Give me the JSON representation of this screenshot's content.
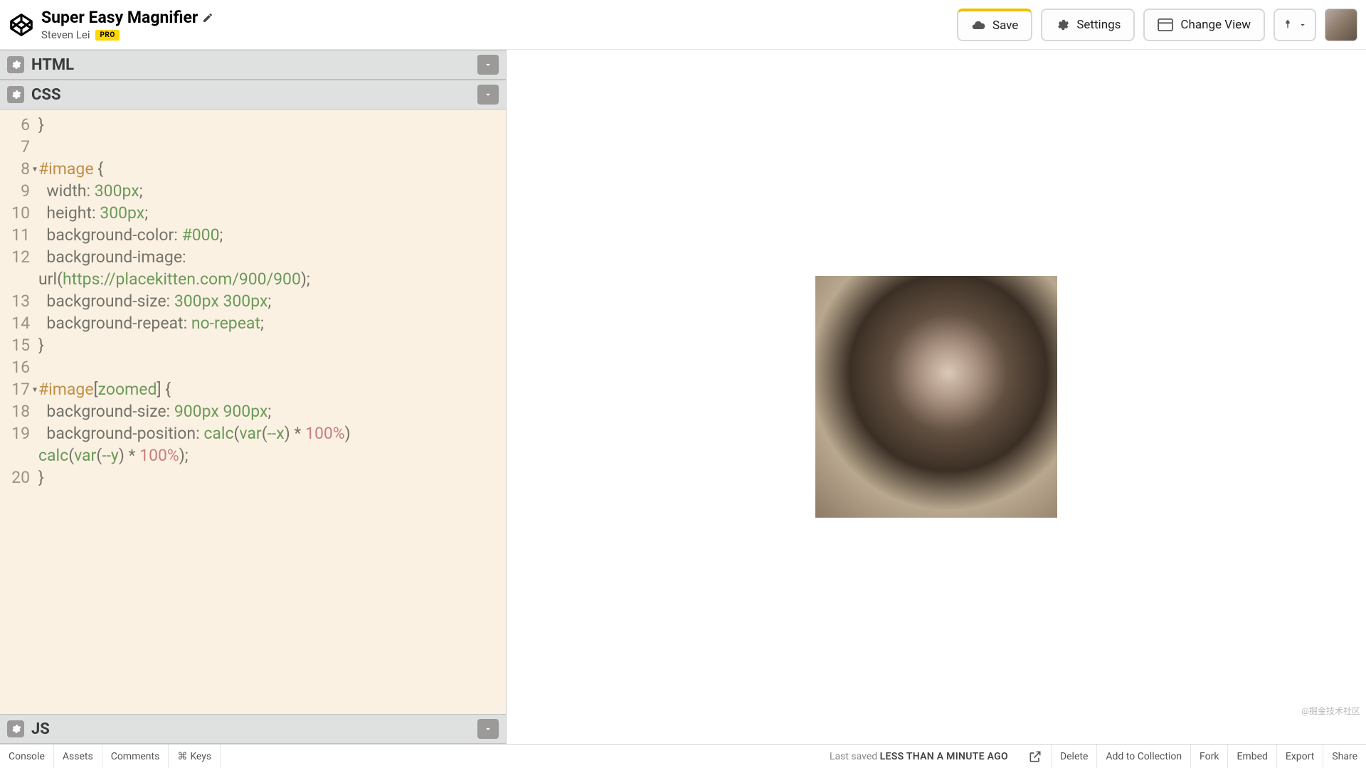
{
  "header": {
    "title": "Super Easy Magnifier",
    "author": "Steven Lei",
    "badge": "PRO"
  },
  "actions": {
    "save": "Save",
    "settings": "Settings",
    "change_view": "Change View"
  },
  "panels": {
    "html": "HTML",
    "css": "CSS",
    "js": "JS"
  },
  "code": {
    "lines": [
      {
        "n": 6,
        "indent": 0,
        "fold": "",
        "tokens": [
          [
            "punc",
            "}"
          ]
        ]
      },
      {
        "n": 7,
        "indent": 0,
        "fold": "",
        "tokens": []
      },
      {
        "n": 8,
        "indent": 0,
        "fold": "▾",
        "tokens": [
          [
            "sel",
            "#image"
          ],
          [
            "punc",
            " {"
          ]
        ]
      },
      {
        "n": 9,
        "indent": 2,
        "fold": "",
        "tokens": [
          [
            "prop",
            "width"
          ],
          [
            "punc",
            ": "
          ],
          [
            "val",
            "300px"
          ],
          [
            "punc",
            ";"
          ]
        ]
      },
      {
        "n": 10,
        "indent": 2,
        "fold": "",
        "tokens": [
          [
            "prop",
            "height"
          ],
          [
            "punc",
            ": "
          ],
          [
            "val",
            "300px"
          ],
          [
            "punc",
            ";"
          ]
        ]
      },
      {
        "n": 11,
        "indent": 2,
        "fold": "",
        "tokens": [
          [
            "prop",
            "background-color"
          ],
          [
            "punc",
            ": "
          ],
          [
            "val",
            "#000"
          ],
          [
            "punc",
            ";"
          ]
        ]
      },
      {
        "n": 12,
        "indent": 2,
        "fold": "",
        "tokens": [
          [
            "prop",
            "background-image"
          ],
          [
            "punc",
            ":"
          ]
        ]
      },
      {
        "n": "",
        "indent": 0,
        "fold": "",
        "tokens": [
          [
            "urlp",
            "url("
          ],
          [
            "url",
            "https://placekitten.com/900/900"
          ],
          [
            "urlp",
            ")"
          ],
          [
            "punc",
            ";"
          ]
        ]
      },
      {
        "n": 13,
        "indent": 2,
        "fold": "",
        "tokens": [
          [
            "prop",
            "background-size"
          ],
          [
            "punc",
            ": "
          ],
          [
            "val",
            "300px 300px"
          ],
          [
            "punc",
            ";"
          ]
        ]
      },
      {
        "n": 14,
        "indent": 2,
        "fold": "",
        "tokens": [
          [
            "prop",
            "background-repeat"
          ],
          [
            "punc",
            ": "
          ],
          [
            "val",
            "no-repeat"
          ],
          [
            "punc",
            ";"
          ]
        ]
      },
      {
        "n": 15,
        "indent": 0,
        "fold": "",
        "tokens": [
          [
            "punc",
            "}"
          ]
        ]
      },
      {
        "n": 16,
        "indent": 0,
        "fold": "",
        "tokens": []
      },
      {
        "n": 17,
        "indent": 0,
        "fold": "▾",
        "tokens": [
          [
            "sel",
            "#image"
          ],
          [
            "punc",
            "["
          ],
          [
            "val",
            "zoomed"
          ],
          [
            "punc",
            "]"
          ],
          [
            "punc",
            " {"
          ]
        ]
      },
      {
        "n": 18,
        "indent": 2,
        "fold": "",
        "tokens": [
          [
            "prop",
            "background-size"
          ],
          [
            "punc",
            ": "
          ],
          [
            "val",
            "900px 900px"
          ],
          [
            "punc",
            ";"
          ]
        ]
      },
      {
        "n": 19,
        "indent": 2,
        "fold": "",
        "tokens": [
          [
            "prop",
            "background-position"
          ],
          [
            "punc",
            ": "
          ],
          [
            "val",
            "calc"
          ],
          [
            "punc",
            "("
          ],
          [
            "val",
            "var"
          ],
          [
            "punc",
            "("
          ],
          [
            "val",
            "--x"
          ],
          [
            "punc",
            ") * "
          ],
          [
            "num",
            "100%"
          ],
          [
            "punc",
            ")"
          ]
        ]
      },
      {
        "n": "",
        "indent": 0,
        "fold": "",
        "tokens": [
          [
            "val",
            "calc"
          ],
          [
            "punc",
            "("
          ],
          [
            "val",
            "var"
          ],
          [
            "punc",
            "("
          ],
          [
            "val",
            "--y"
          ],
          [
            "punc",
            ") * "
          ],
          [
            "num",
            "100%"
          ],
          [
            "punc",
            ");"
          ]
        ]
      },
      {
        "n": 20,
        "indent": 0,
        "fold": "",
        "tokens": [
          [
            "punc",
            "}"
          ]
        ]
      }
    ]
  },
  "status": {
    "console": "Console",
    "assets": "Assets",
    "comments": "Comments",
    "keys": "Keys",
    "keys_prefix": "⌘",
    "saved_prefix": "Last saved ",
    "saved_bold": "LESS THAN A MINUTE AGO",
    "delete": "Delete",
    "add_collection": "Add to Collection",
    "fork": "Fork",
    "embed": "Embed",
    "export": "Export",
    "share": "Share"
  },
  "watermark": "@掘金技术社区"
}
